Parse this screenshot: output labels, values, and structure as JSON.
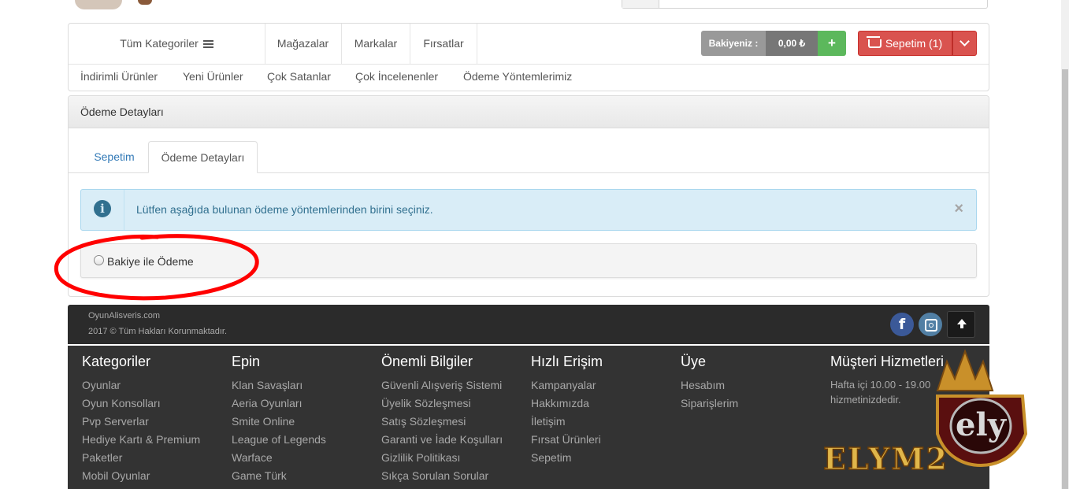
{
  "nav": {
    "categories_label": "Tüm Kategoriler",
    "links": [
      "Mağazalar",
      "Markalar",
      "Fırsatlar"
    ],
    "balance_label": "Bakiyeniz :",
    "balance_value": "0,00 ₺",
    "add_balance": "+",
    "cart_label": "Sepetim (1)",
    "sub_links": [
      "İndirimli Ürünler",
      "Yeni Ürünler",
      "Çok Satanlar",
      "Çok İncelenenler",
      "Ödeme Yöntemlerimiz"
    ]
  },
  "panel": {
    "title": "Ödeme Detayları",
    "tabs": [
      "Sepetim",
      "Ödeme Detayları"
    ],
    "alert_text": "Lütfen aşağıda bulunan ödeme yöntemlerinden birini seçiniz.",
    "alert_close": "×",
    "payment_option": "Bakiye ile Ödeme"
  },
  "footer": {
    "site": "OyunAlisveris.com",
    "copyright": "2017 © Tüm Hakları Korunmaktadır.",
    "facebook": "f",
    "columns": [
      {
        "title": "Kategoriler",
        "links": [
          "Oyunlar",
          "Oyun Konsolları",
          "Pvp Serverlar",
          "Hediye Kartı & Premium",
          "Paketler",
          "Mobil Oyunlar"
        ]
      },
      {
        "title": "Epin",
        "links": [
          "Klan Savaşları",
          "Aeria Oyunları",
          "Smite Online",
          "League of Legends",
          "Warface",
          "Game Türk"
        ]
      },
      {
        "title": "Önemli Bilgiler",
        "links": [
          "Güvenli Alışveriş Sistemi",
          "Üyelik Sözleşmesi",
          "Satış Sözleşmesi",
          "Garanti ve İade Koşulları",
          "Gizlilik Politikası",
          "Sıkça Sorulan Sorular"
        ]
      },
      {
        "title": "Hızlı Erişim",
        "links": [
          "Kampanyalar",
          "Hakkımızda",
          "İletişim",
          "Fırsat Ürünleri",
          "Sepetim"
        ]
      },
      {
        "title": "Üye",
        "links": [
          "Hesabım",
          "Siparişlerim"
        ]
      },
      {
        "title": "Müşteri Hizmetleri",
        "links": [
          "Hafta içi 10.00 - 19.00",
          "hizmetinizdedir."
        ]
      }
    ]
  },
  "watermark": {
    "text": "ELYM2",
    "monogram": "ely"
  },
  "colors": {
    "accent_red": "#d9534f",
    "accent_green": "#5cb85c",
    "info_bg": "#d9edf7",
    "footer_bg": "#333333"
  }
}
